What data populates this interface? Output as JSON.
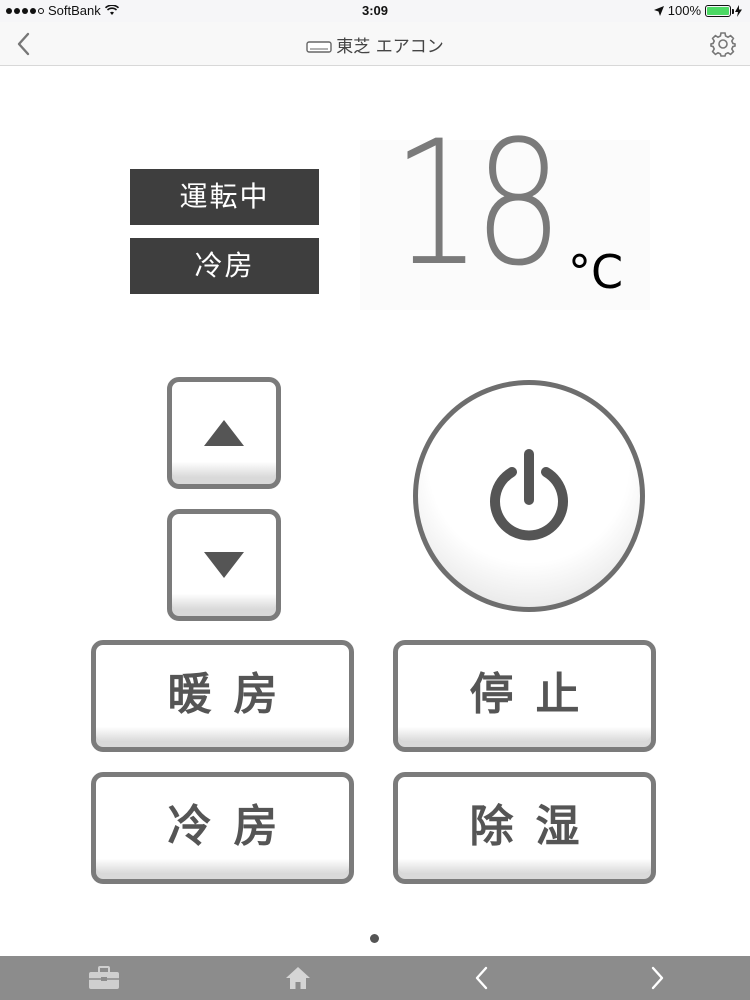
{
  "status_bar": {
    "carrier": "SoftBank",
    "time": "3:09",
    "battery": "100%"
  },
  "nav": {
    "title": "東芝 エアコン",
    "back_icon": "chevron-left-icon",
    "settings_icon": "gear-icon"
  },
  "display": {
    "run_status": "運転中",
    "mode": "冷房",
    "temperature": "18",
    "unit": "°C"
  },
  "controls": {
    "heat_label": "暖房",
    "stop_label": "停止",
    "cool_label": "冷房",
    "dry_label": "除湿"
  },
  "toolbar": {
    "items": [
      "toolbox-icon",
      "home-icon",
      "chevron-left-icon",
      "chevron-right-icon"
    ]
  },
  "colors": {
    "status_box": "#3e3e3e",
    "temperature": "#7a7a7a",
    "button_border": "#7b7b7b",
    "toolbar": "#8c8c8c",
    "battery": "#4cd964"
  }
}
